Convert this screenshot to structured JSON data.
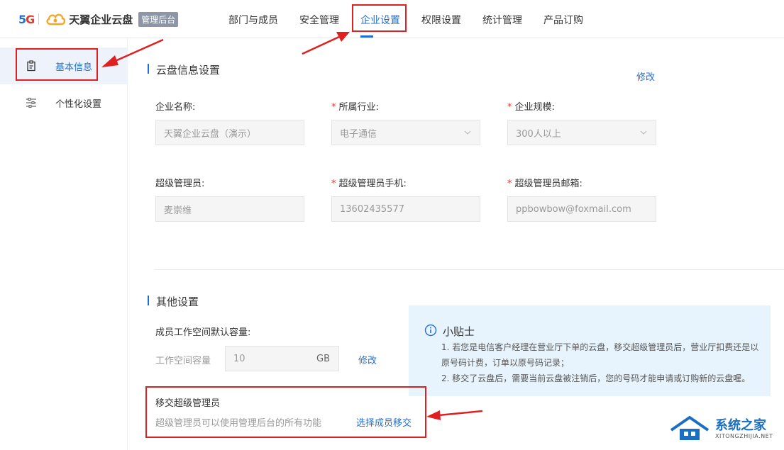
{
  "header": {
    "logo_5g_a": "5",
    "logo_5g_b": "G",
    "brand": "天翼企业云盘",
    "badge": "管理后台",
    "nav": [
      "部门与成员",
      "安全管理",
      "企业设置",
      "权限设置",
      "统计管理",
      "产品订购"
    ],
    "active_nav": "企业设置"
  },
  "sidebar": {
    "items": [
      {
        "label": "基本信息",
        "icon": "clipboard-icon"
      },
      {
        "label": "个性化设置",
        "icon": "sliders-icon"
      }
    ]
  },
  "cloud_info": {
    "title": "云盘信息设置",
    "edit_label": "修改",
    "fields": [
      {
        "label": "企业名称:",
        "required": false,
        "value": "天翼企业云盘（演示）"
      },
      {
        "label": "所属行业:",
        "required": true,
        "value": "电子通信"
      },
      {
        "label": "企业规模:",
        "required": true,
        "value": "300人以上"
      },
      {
        "label": "超级管理员:",
        "required": false,
        "value": "麦崇维"
      },
      {
        "label": "超级管理员手机:",
        "required": true,
        "value": "13602435577"
      },
      {
        "label": "超级管理员邮箱:",
        "required": true,
        "value": "ppbowbow@foxmail.com"
      }
    ],
    "required_mark": "*"
  },
  "other_settings": {
    "title": "其他设置",
    "workspace_label": "成员工作空间默认容量:",
    "capacity_label": "工作空间容量",
    "capacity_value": "10",
    "capacity_unit": "GB",
    "capacity_edit": "修改",
    "transfer_title": "移交超级管理员",
    "transfer_desc": "超级管理员可以使用管理后台的所有功能",
    "transfer_link": "选择成员移交"
  },
  "tips": {
    "title": "小贴士",
    "lines": [
      "1. 若您是电信客户经理在营业厅下单的云盘，移交超级管理员后，营业厅扣费还是以",
      "原号码计费，订单以原号码记录；",
      "2. 移交了云盘后，需要当前云盘被注销后，您的号码才能申请或订购新的云盘喔。"
    ]
  },
  "watermark": {
    "main": "系统之家",
    "sub": "XITONGZHIJIA.NET"
  },
  "colors": {
    "accent": "#1f6fd6",
    "required": "#e23a2e",
    "annotation": "#e02020",
    "tips_bg": "#e8f4fd"
  }
}
